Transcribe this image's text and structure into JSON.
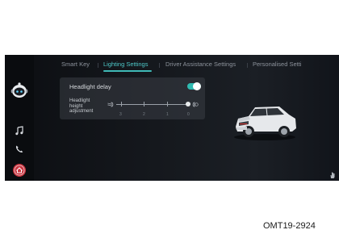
{
  "tabs": [
    {
      "label": "Smart Key",
      "active": false
    },
    {
      "label": "Lighting Settings",
      "active": true
    },
    {
      "label": "Driver Assistance Settings",
      "active": false
    },
    {
      "label": "Personalised Setti",
      "active": false
    }
  ],
  "settings": {
    "headlight_delay": {
      "label": "Headlight delay",
      "enabled": true
    },
    "headlight_height": {
      "label_line1": "Headlight",
      "label_line2": "height",
      "label_line3": "adjustment",
      "scale": [
        "3",
        "2",
        "1",
        "0"
      ],
      "selected": "0"
    }
  },
  "sidebar": {
    "icons": [
      "assistant-robot-icon",
      "music-icon",
      "phone-icon",
      "home-icon"
    ]
  },
  "caption": "OMT19-2924",
  "colors": {
    "accent": "#3fb9b6",
    "background": "#15181d"
  }
}
